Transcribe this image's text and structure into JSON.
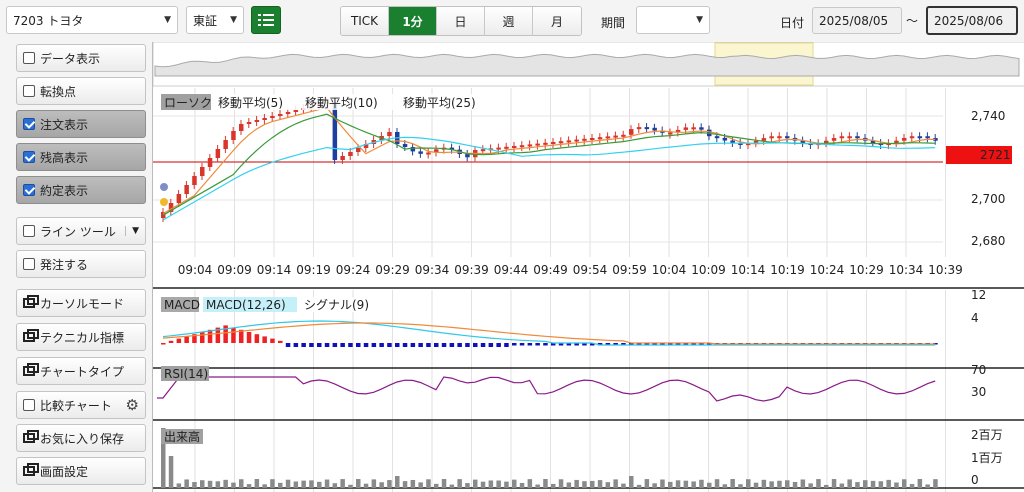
{
  "header": {
    "symbol": "7203 トヨタ",
    "exchange": "東証",
    "tabs": [
      "TICK",
      "1分",
      "日",
      "週",
      "月"
    ],
    "active_tab": "1分",
    "period_label": "期間",
    "period_value": "",
    "date_label": "日付",
    "date_from": "2025/08/05",
    "date_sep": "〜",
    "date_to": "2025/08/06"
  },
  "sidebar": {
    "items": [
      {
        "label": "データ表示",
        "kind": "check",
        "checked": false
      },
      {
        "label": "転換点",
        "kind": "check",
        "checked": false
      },
      {
        "label": "注文表示",
        "kind": "check",
        "checked": true
      },
      {
        "label": "残高表示",
        "kind": "check",
        "checked": true
      },
      {
        "label": "約定表示",
        "kind": "check",
        "checked": true
      },
      {
        "label": "ライン ツール",
        "kind": "check",
        "checked": false
      },
      {
        "label": "発注する",
        "kind": "check",
        "checked": false
      },
      {
        "label": "カーソルモード",
        "kind": "window"
      },
      {
        "label": "テクニカル指標",
        "kind": "window"
      },
      {
        "label": "チャートタイプ",
        "kind": "window"
      },
      {
        "label": "比較チャート",
        "kind": "check",
        "checked": false
      },
      {
        "label": "お気に入り保存",
        "kind": "window"
      },
      {
        "label": "画面設定",
        "kind": "window"
      }
    ]
  },
  "main_chart": {
    "legend": [
      {
        "label": "ローソク",
        "color": "#a0a0a0"
      },
      {
        "label": "移動平均(5)",
        "color": "#f08a3c"
      },
      {
        "label": "移動平均(10)",
        "color": "#3a9a3a"
      },
      {
        "label": "移動平均(25)",
        "color": "#33d1f0"
      }
    ],
    "y_ticks": [
      "2,740",
      "2,700",
      "2,680"
    ],
    "current_price": "2721",
    "x_ticks": [
      "09:04",
      "09:09",
      "09:14",
      "09:19",
      "09:24",
      "09:29",
      "09:34",
      "09:39",
      "09:44",
      "09:49",
      "09:54",
      "09:59",
      "10:04",
      "10:09",
      "10:14",
      "10:19",
      "10:24",
      "10:29",
      "10:34",
      "10:39"
    ]
  },
  "macd": {
    "legend": [
      "MACD",
      "MACD(12,26)",
      "シグナル(9)"
    ],
    "y_ticks": [
      "12",
      "4"
    ]
  },
  "rsi": {
    "legend": "RSI(14)",
    "y_ticks": [
      "70",
      "30"
    ]
  },
  "volume": {
    "legend": "出来高",
    "y_ticks": [
      "2百万",
      "1百万",
      "0"
    ]
  },
  "colors": {
    "up": "#d9362b",
    "down": "#1f3f9f",
    "accent": "#1a7f2e",
    "price_line": "#cc0000",
    "rsi": "#8a1a8a"
  }
}
